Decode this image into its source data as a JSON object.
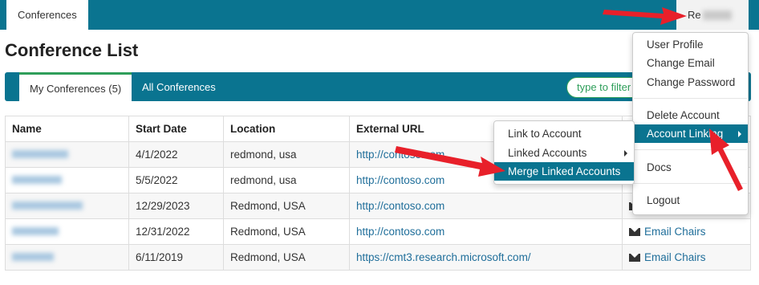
{
  "topbar": {
    "tab_label": "Conferences",
    "user_label": "Re"
  },
  "page": {
    "title": "Conference List"
  },
  "tabs": {
    "my": "My Conferences (5)",
    "all": "All Conferences"
  },
  "filter": {
    "placeholder": "type to filter"
  },
  "table": {
    "headers": [
      "Name",
      "Start Date",
      "Location",
      "External URL",
      ""
    ],
    "rows": [
      {
        "date": "4/1/2022",
        "location": "redmond, usa",
        "url": "http://contoso.com",
        "action": ""
      },
      {
        "date": "5/5/2022",
        "location": "redmond, usa",
        "url": "http://contoso.com",
        "action": ""
      },
      {
        "date": "12/29/2023",
        "location": "Redmond, USA",
        "url": "http://contoso.com",
        "action": ""
      },
      {
        "date": "12/31/2022",
        "location": "Redmond, USA",
        "url": "http://contoso.com",
        "action": "Email Chairs"
      },
      {
        "date": "6/11/2019",
        "location": "Redmond, USA",
        "url": "https://cmt3.research.microsoft.com/",
        "action": "Email Chairs"
      }
    ]
  },
  "user_dropdown": {
    "items": [
      "User Profile",
      "Change Email",
      "Change Password",
      "Delete Account",
      "Account Linking",
      "Docs",
      "Logout"
    ]
  },
  "submenu": {
    "items": [
      "Link to Account",
      "Linked Accounts",
      "Merge Linked Accounts"
    ]
  },
  "colors": {
    "brand": "#0a7490",
    "accent": "#2e9e5a",
    "arrow": "#e8202a",
    "link": "#1f6e9a"
  },
  "icons": {
    "envelope": "envelope-icon",
    "submenu_caret": "caret-right-icon"
  }
}
